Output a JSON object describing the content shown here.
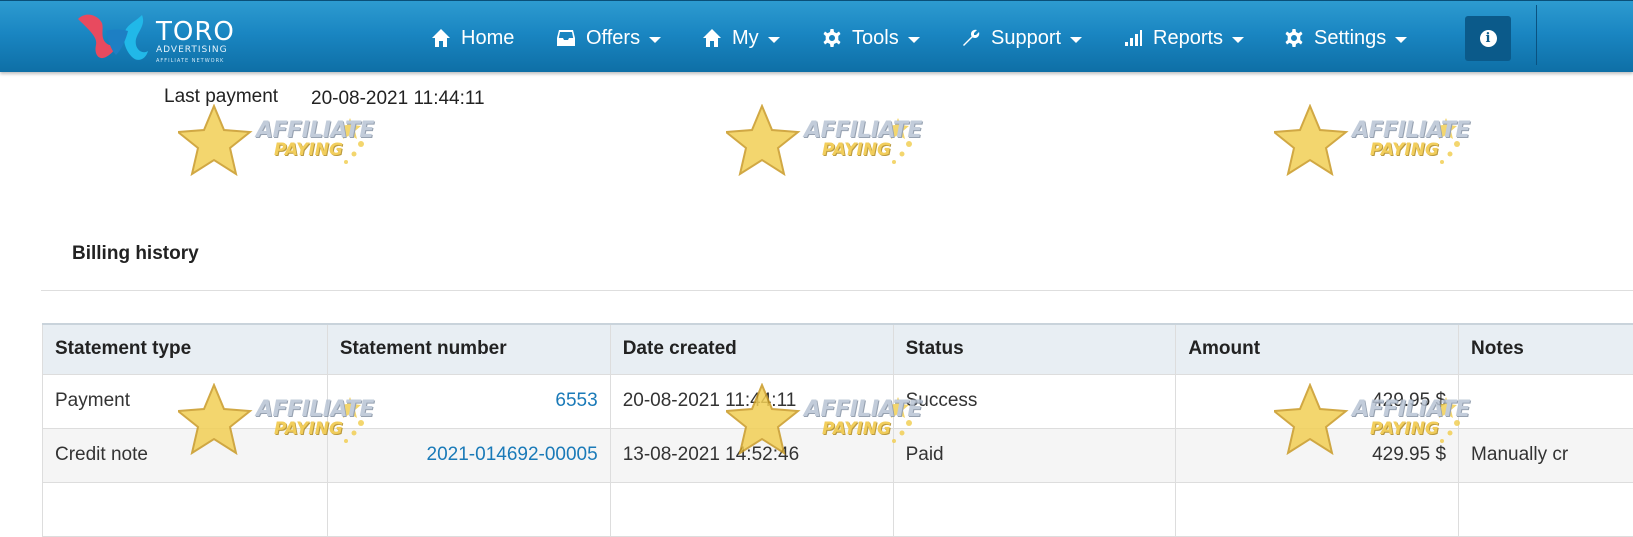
{
  "brand": {
    "name": "TORO",
    "sub": "ADVERTISING",
    "tagline": "AFFILIATE NETWORK"
  },
  "nav": [
    {
      "label": "Home",
      "icon": "home-icon",
      "caret": false
    },
    {
      "label": "Offers",
      "icon": "inbox-icon",
      "caret": true
    },
    {
      "label": "My",
      "icon": "home-icon",
      "caret": true
    },
    {
      "label": "Tools",
      "icon": "gear-icon",
      "caret": true
    },
    {
      "label": "Support",
      "icon": "wrench-icon",
      "caret": true
    },
    {
      "label": "Reports",
      "icon": "signal-icon",
      "caret": true
    },
    {
      "label": "Settings",
      "icon": "gear-icon",
      "caret": true
    }
  ],
  "info_button": {
    "icon": "info-icon",
    "glyph": "i"
  },
  "last_payment": {
    "label": "Last payment",
    "value": "20-08-2021 11:44:11"
  },
  "billing": {
    "title": "Billing history",
    "columns": [
      "Statement type",
      "Statement number",
      "Date created",
      "Status",
      "Amount",
      "Notes"
    ],
    "rows": [
      {
        "type": "Payment",
        "number": "6553",
        "date": "20-08-2021 11:44:11",
        "status": "Success",
        "amount": "429.95 $",
        "notes": ""
      },
      {
        "type": "Credit note",
        "number": "2021-014692-00005",
        "date": "13-08-2021 14:52:46",
        "status": "Paid",
        "amount": "429.95 $",
        "notes": "Manually cr"
      },
      {
        "type": "",
        "number": "",
        "date": "",
        "status": "",
        "amount": "",
        "notes": ""
      }
    ]
  },
  "watermark": {
    "line1": "AFFILIATE",
    "line2": "PAYING"
  },
  "colors": {
    "navbar": "#1a86c2",
    "link": "#1a7ab8",
    "header_row": "#e8eef3",
    "watermark_gold": "#f0c640"
  }
}
